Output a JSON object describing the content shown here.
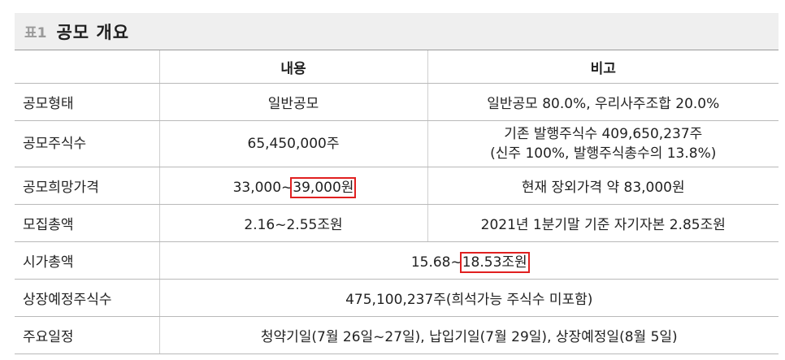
{
  "title": {
    "prefix": "표1",
    "text": "공모 개요"
  },
  "table": {
    "headers": [
      "",
      "내용",
      "비고"
    ],
    "rows": [
      {
        "label": "공모형태",
        "content": "일반공모",
        "note": "일반공모 80.0%, 우리사주조합 20.0%"
      },
      {
        "label": "공모주식수",
        "content": "65,450,000주",
        "note_line1": "기존 발행주식수 409,650,237주",
        "note_line2": "(신주 100%, 발행주식총수의 13.8%)"
      },
      {
        "label": "공모희망가격",
        "content_pre": "33,000~",
        "content_highlight": "39,000원",
        "note": "현재 장외가격 약 83,000원"
      },
      {
        "label": "모집총액",
        "content": "2.16~2.55조원",
        "note": "2021년 1분기말 기준 자기자본 2.85조원"
      },
      {
        "label": "시가총액",
        "content_pre": "15.68~",
        "content_highlight": "18.53조원"
      },
      {
        "label": "상장예정주식수",
        "content": "475,100,237주(희석가능 주식수 미포함)"
      },
      {
        "label": "주요일정",
        "content": "청약기일(7월 26일~27일), 납입기일(7월 29일), 상장예정일(8월 5일)"
      }
    ]
  }
}
